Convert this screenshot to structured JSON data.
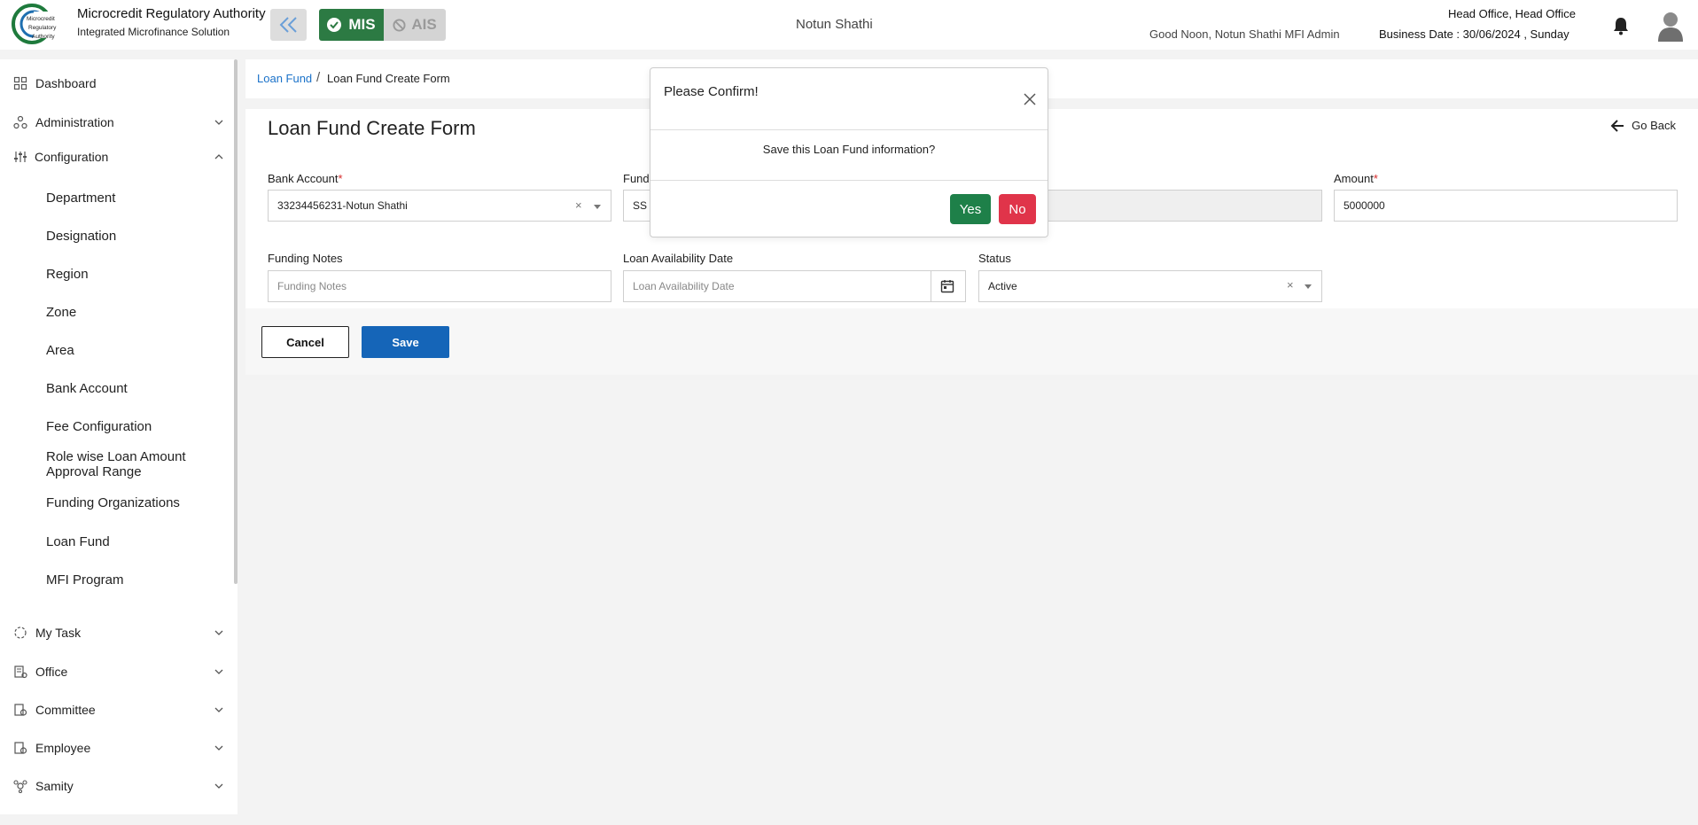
{
  "header": {
    "org_name": "Microcredit Regulatory Authority",
    "org_sub": "Integrated Microfinance Solution",
    "logo_text": "Microcredit Regulatory Authority",
    "mis_label": "MIS",
    "ais_label": "AIS",
    "center_name": "Notun Shathi",
    "greeting": "Good Noon, Notun Shathi MFI Admin",
    "office": "Head Office, Head Office",
    "business_date": "Business Date : 30/06/2024 , Sunday",
    "accent_green": "#2c7a43"
  },
  "sidebar": {
    "items": [
      {
        "label": "Dashboard",
        "icon": "grid-icon"
      },
      {
        "label": "Administration",
        "icon": "admin-icon"
      },
      {
        "label": "Configuration",
        "icon": "sliders-icon"
      }
    ],
    "config_sub": [
      "Department",
      "Designation",
      "Region",
      "Zone",
      "Area",
      "Bank Account",
      "Fee Configuration",
      "Role wise Loan Amount Approval Range",
      "Funding Organizations",
      "Loan Fund",
      "MFI Program"
    ],
    "bottom_items": [
      {
        "label": "My Task",
        "icon": "task-icon"
      },
      {
        "label": "Office",
        "icon": "office-icon"
      },
      {
        "label": "Committee",
        "icon": "committee-icon"
      },
      {
        "label": "Employee",
        "icon": "employee-icon"
      },
      {
        "label": "Samity",
        "icon": "samity-icon"
      }
    ]
  },
  "breadcrumb": {
    "parent": "Loan Fund",
    "separator": "/",
    "current": "Loan Fund Create Form"
  },
  "form": {
    "title": "Loan Fund Create Form",
    "go_back": "Go Back",
    "bank_account": {
      "label": "Bank Account",
      "required": "*",
      "value": "33234456231-Notun Shathi"
    },
    "funding": {
      "label": "Fundi",
      "value": "SS"
    },
    "amount": {
      "label": "Amount",
      "required": "*",
      "value": "5000000"
    },
    "funding_notes": {
      "label": "Funding Notes",
      "placeholder": "Funding Notes"
    },
    "availability_date": {
      "label": "Loan Availability Date",
      "placeholder": "Loan Availability Date"
    },
    "status": {
      "label": "Status",
      "value": "Active"
    },
    "cancel_label": "Cancel",
    "save_label": "Save"
  },
  "modal": {
    "title": "Please Confirm!",
    "message": "Save this Loan Fund information?",
    "yes_label": "Yes",
    "no_label": "No"
  }
}
